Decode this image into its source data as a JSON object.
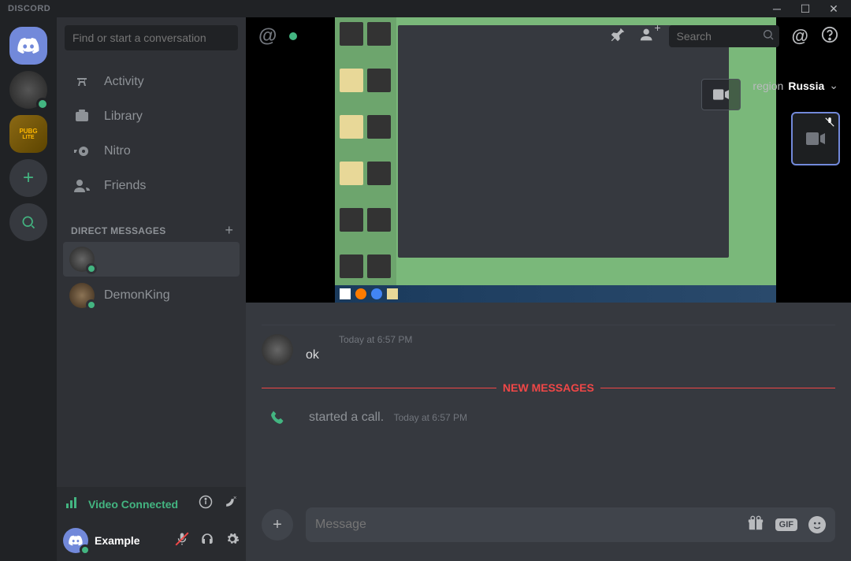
{
  "titlebar": {
    "title": "DISCORD"
  },
  "search": {
    "placeholder": "Find or start a conversation"
  },
  "nav": {
    "activity": "Activity",
    "library": "Library",
    "nitro": "Nitro",
    "friends": "Friends"
  },
  "dm": {
    "header": "DIRECT MESSAGES",
    "items": [
      {
        "name": ""
      },
      {
        "name": "DemonKing"
      }
    ]
  },
  "voice": {
    "status": "Video Connected"
  },
  "user": {
    "name": "Example"
  },
  "header": {
    "search_placeholder": "Search",
    "region_label": "region",
    "region_value": "Russia"
  },
  "messages": {
    "msg1_time": "Today at 6:57 PM",
    "msg1_text": "ok",
    "divider": "NEW MESSAGES",
    "call_text": "started a call.",
    "call_time": "Today at 6:57 PM"
  },
  "input": {
    "placeholder": "Message",
    "gif": "GIF"
  },
  "server": {
    "pubg_line1": "PUBG",
    "pubg_line2": "LITE"
  }
}
